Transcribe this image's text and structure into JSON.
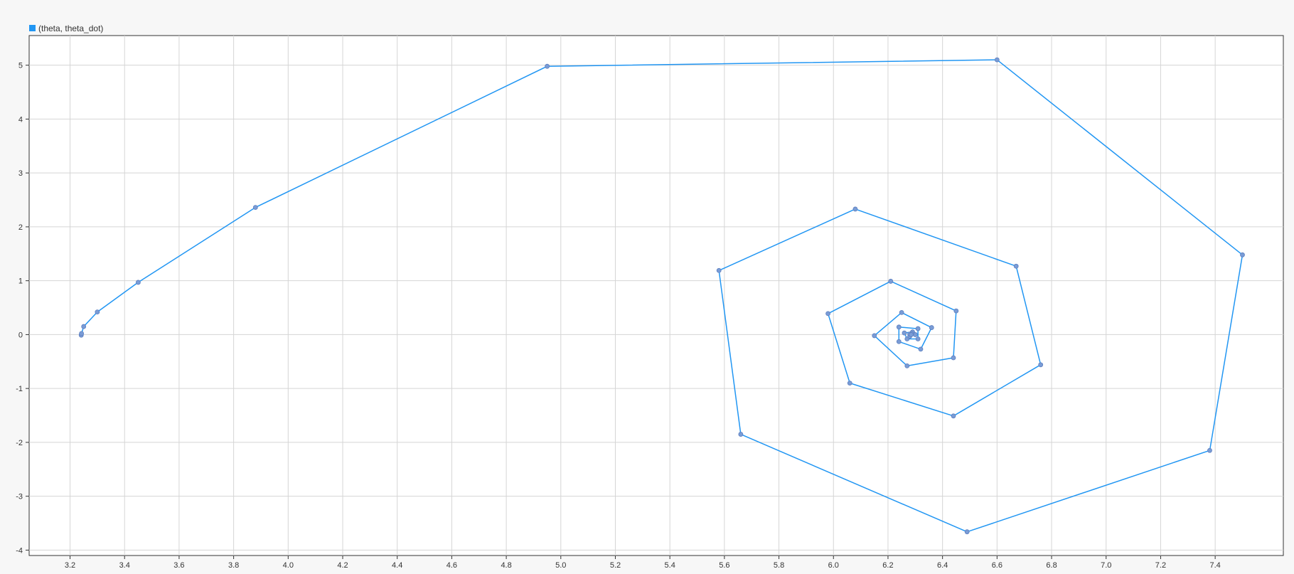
{
  "chart_data": {
    "type": "line",
    "title": "",
    "xlabel": "",
    "ylabel": "",
    "legend": {
      "position": "top-left",
      "entries": [
        "(theta, theta_dot)"
      ]
    },
    "grid": true,
    "xlim": [
      3.05,
      7.65
    ],
    "ylim": [
      -4.1,
      5.55
    ],
    "x_ticks": [
      "3.2",
      "3.4",
      "3.6",
      "3.8",
      "4.0",
      "4.2",
      "4.4",
      "4.6",
      "4.8",
      "5.0",
      "5.2",
      "5.4",
      "5.6",
      "5.8",
      "6.0",
      "6.2",
      "6.4",
      "6.6",
      "6.8",
      "7.0",
      "7.2",
      "7.4"
    ],
    "y_ticks": [
      "-4",
      "-3",
      "-2",
      "-1",
      "0",
      "1",
      "2",
      "3",
      "4",
      "5"
    ],
    "series": [
      {
        "name": "(theta, theta_dot)",
        "color": "#2196F3",
        "marker_color": "#7A9CD6",
        "points": [
          [
            3.241,
            -0.01
          ],
          [
            3.242,
            0.02
          ],
          [
            3.25,
            0.15
          ],
          [
            3.3,
            0.42
          ],
          [
            3.45,
            0.97
          ],
          [
            3.88,
            2.36
          ],
          [
            4.95,
            4.98
          ],
          [
            6.6,
            5.1
          ],
          [
            7.5,
            1.48
          ],
          [
            7.38,
            -2.15
          ],
          [
            6.49,
            -3.66
          ],
          [
            5.66,
            -1.85
          ],
          [
            5.58,
            1.19
          ],
          [
            6.08,
            2.33
          ],
          [
            6.67,
            1.27
          ],
          [
            6.76,
            -0.56
          ],
          [
            6.44,
            -1.51
          ],
          [
            6.06,
            -0.9
          ],
          [
            5.98,
            0.39
          ],
          [
            6.21,
            0.99
          ],
          [
            6.45,
            0.44
          ],
          [
            6.44,
            -0.43
          ],
          [
            6.27,
            -0.58
          ],
          [
            6.15,
            -0.02
          ],
          [
            6.25,
            0.41
          ],
          [
            6.36,
            0.13
          ],
          [
            6.32,
            -0.27
          ],
          [
            6.24,
            -0.13
          ],
          [
            6.24,
            0.14
          ],
          [
            6.31,
            0.11
          ],
          [
            6.31,
            -0.08
          ],
          [
            6.27,
            -0.08
          ],
          [
            6.26,
            0.03
          ],
          [
            6.29,
            0.05
          ],
          [
            6.3,
            0.0
          ],
          [
            6.28,
            -0.03
          ],
          [
            6.28,
            0.01
          ],
          [
            6.287,
            0.02
          ],
          [
            6.285,
            0.0
          ]
        ]
      }
    ]
  }
}
